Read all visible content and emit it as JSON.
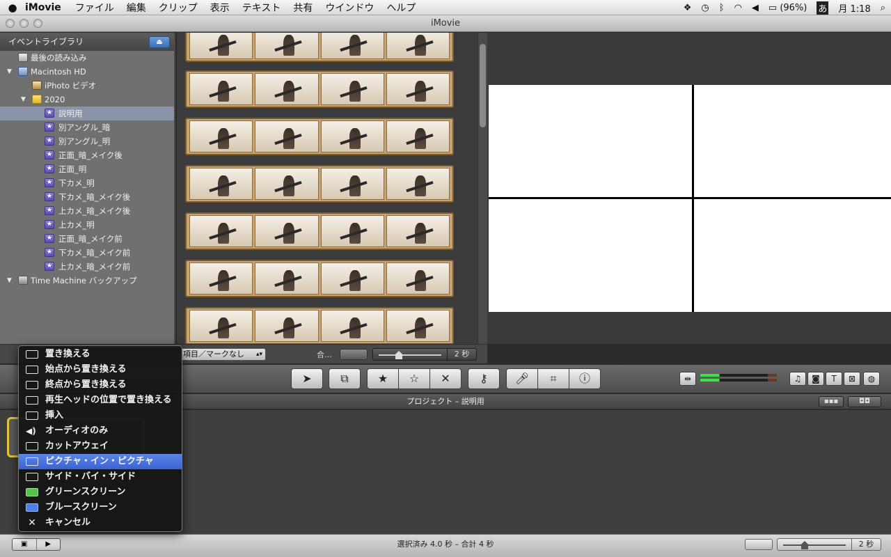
{
  "menubar": {
    "apple": "",
    "app_name": "iMovie",
    "menus": [
      "ファイル",
      "編集",
      "クリップ",
      "表示",
      "テキスト",
      "共有",
      "ウインドウ",
      "ヘルプ"
    ],
    "battery": "(96%)",
    "input_method": "あ",
    "clock": "月 1:18"
  },
  "window": {
    "title": "iMovie"
  },
  "library": {
    "header": "イベントライブラリ",
    "items": [
      {
        "label": "最後の読み込み",
        "icon": "recent-import-icon"
      },
      {
        "label": "Macintosh HD",
        "icon": "hard-disk-icon"
      },
      {
        "label": "iPhoto ビデオ",
        "icon": "iphoto-icon"
      },
      {
        "label": "2020",
        "icon": "folder-icon"
      },
      {
        "label": "説明用",
        "icon": "event-star-icon"
      },
      {
        "label": "別アングル_暗",
        "icon": "event-star-icon"
      },
      {
        "label": "別アングル_明",
        "icon": "event-star-icon"
      },
      {
        "label": "正面_暗_メイク後",
        "icon": "event-star-icon"
      },
      {
        "label": "正面_明",
        "icon": "event-star-icon"
      },
      {
        "label": "下カメ_明",
        "icon": "event-star-icon"
      },
      {
        "label": "下カメ_暗_メイク後",
        "icon": "event-star-icon"
      },
      {
        "label": "上カメ_暗_メイク後",
        "icon": "event-star-icon"
      },
      {
        "label": "上カメ_明",
        "icon": "event-star-icon"
      },
      {
        "label": "正面_暗_メイク前",
        "icon": "event-star-icon"
      },
      {
        "label": "下カメ_暗_メイク前",
        "icon": "event-star-icon"
      },
      {
        "label": "上カメ_暗_メイク前",
        "icon": "event-star-icon"
      },
      {
        "label": "Time Machine バックアップ",
        "icon": "time-machine-icon"
      }
    ]
  },
  "browserbar": {
    "filter": "項目／マークなし",
    "label": "合…",
    "zoom_value": "2 秒"
  },
  "project": {
    "title": "プロジェクト – 説明用"
  },
  "status": {
    "text": "選択済み 4.0 秒 – 合計 4 秒",
    "zoom_value": "2 秒"
  },
  "context_menu": {
    "items": [
      {
        "label": "置き換える",
        "icon": "replace-icon"
      },
      {
        "label": "始点から置き換える",
        "icon": "replace-from-start-icon"
      },
      {
        "label": "終点から置き換える",
        "icon": "replace-from-end-icon"
      },
      {
        "label": "再生ヘッドの位置で置き換える",
        "icon": "replace-at-playhead-icon"
      },
      {
        "label": "挿入",
        "icon": "insert-icon"
      },
      {
        "label": "オーディオのみ",
        "icon": "speaker-icon"
      },
      {
        "label": "カットアウェイ",
        "icon": "cutaway-icon"
      },
      {
        "label": "ピクチャ・イン・ピクチャ",
        "icon": "picture-in-picture-icon"
      },
      {
        "label": "サイド・バイ・サイド",
        "icon": "side-by-side-icon"
      },
      {
        "label": "グリーンスクリーン",
        "icon": "green-screen-icon"
      },
      {
        "label": "ブルースクリーン",
        "icon": "blue-screen-icon"
      },
      {
        "label": "キャンセル",
        "icon": "cancel-x-icon"
      }
    ],
    "highlight_color": "#3a63d3"
  }
}
